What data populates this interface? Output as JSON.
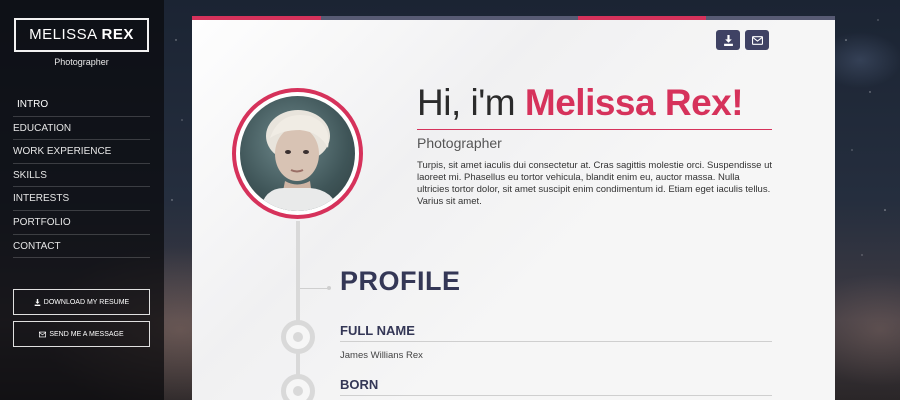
{
  "brand": {
    "first": "MELISSA",
    "last": "REX",
    "subtitle": "Photographer"
  },
  "nav": [
    {
      "label": "INTRO",
      "active": true
    },
    {
      "label": "EDUCATION"
    },
    {
      "label": "WORK EXPERIENCE"
    },
    {
      "label": "SKILLS"
    },
    {
      "label": "INTERESTS"
    },
    {
      "label": "PORTFOLIO"
    },
    {
      "label": "CONTACT"
    }
  ],
  "sidebar_buttons": {
    "download": {
      "label": "DOWNLOAD MY RESUME",
      "icon": "download-icon"
    },
    "message": {
      "label": "SEND ME A MESSAGE",
      "icon": "envelope-icon"
    }
  },
  "toolbar": {
    "download_icon": "download-icon",
    "mail_icon": "envelope-icon"
  },
  "hero": {
    "greeting": "Hi, i'm ",
    "name": "Melissa Rex!",
    "role": "Photographer",
    "bio": "Turpis, sit amet iaculis dui consectetur at. Cras sagittis molestie orci. Suspendisse ut laoreet mi. Phasellus eu tortor vehicula, blandit enim eu, auctor massa. Nulla ultricies tortor dolor, sit amet suscipit enim condimentum id. Etiam eget iaculis tellus. Varius sit amet."
  },
  "profile": {
    "title": "PROFILE",
    "fields": [
      {
        "label": "FULL NAME",
        "value": "James Willians Rex"
      },
      {
        "label": "BORN",
        "value": ""
      }
    ]
  },
  "colors": {
    "accent": "#d6325b",
    "navy": "#3f4264",
    "dark_navy": "#343756",
    "gray_bar": "#585b74"
  }
}
